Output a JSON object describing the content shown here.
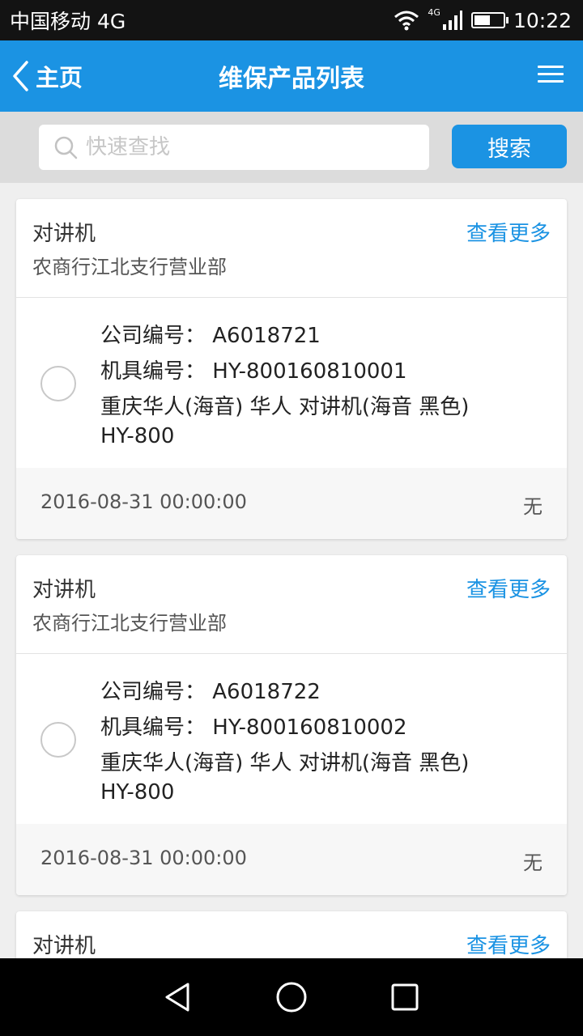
{
  "status_bar": {
    "carrier": "中国移动 4G",
    "network_label": "4G",
    "time": "10:22"
  },
  "nav": {
    "back_label": "主页",
    "title": "维保产品列表"
  },
  "search": {
    "placeholder": "快速查找",
    "button_label": "搜索"
  },
  "cards": [
    {
      "type": "对讲机",
      "org": "农商行江北支行营业部",
      "more_label": "查看更多",
      "company_no": "公司编号：  A6018721",
      "machine_no": "机具编号：  HY-800160810001",
      "desc": "重庆华人(海音) 华人 对讲机(海音 黑色)",
      "model": "HY-800",
      "date": "2016-08-31 00:00:00",
      "status": "无"
    },
    {
      "type": "对讲机",
      "org": "农商行江北支行营业部",
      "more_label": "查看更多",
      "company_no": "公司编号：  A6018722",
      "machine_no": "机具编号：  HY-800160810002",
      "desc": "重庆华人(海音) 华人 对讲机(海音 黑色)",
      "model": "HY-800",
      "date": "2016-08-31 00:00:00",
      "status": "无"
    },
    {
      "type": "对讲机",
      "more_label": "查看更多"
    }
  ],
  "colors": {
    "accent": "#1b93e3",
    "status_bar": "#131313",
    "page_bg": "#efefef"
  }
}
